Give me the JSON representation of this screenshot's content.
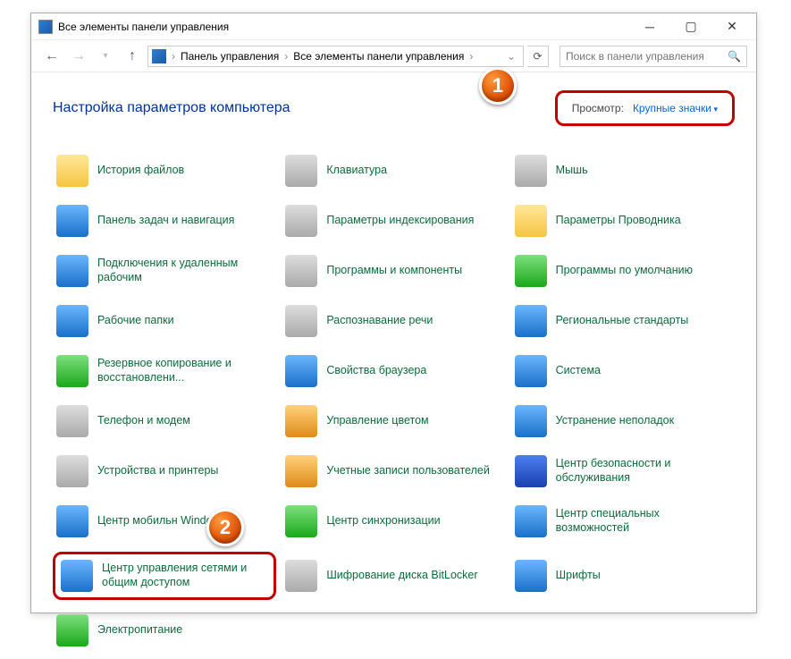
{
  "window": {
    "title": "Все элементы панели управления"
  },
  "nav": {
    "breadcrumb": [
      "Панель управления",
      "Все элементы панели управления"
    ],
    "search_placeholder": "Поиск в панели управления"
  },
  "heading": "Настройка параметров компьютера",
  "view": {
    "label": "Просмотр:",
    "value": "Крупные значки"
  },
  "badges": {
    "one": "1",
    "two": "2"
  },
  "items": [
    {
      "label": "История файлов",
      "icon": "folder-history-icon",
      "cls": "ic-folder"
    },
    {
      "label": "Клавиатура",
      "icon": "keyboard-icon",
      "cls": "ic-gray"
    },
    {
      "label": "Мышь",
      "icon": "mouse-icon",
      "cls": "ic-gray"
    },
    {
      "label": "Панель задач и навигация",
      "icon": "taskbar-icon",
      "cls": "ic-blue"
    },
    {
      "label": "Параметры индексирования",
      "icon": "indexing-icon",
      "cls": "ic-gray"
    },
    {
      "label": "Параметры Проводника",
      "icon": "explorer-options-icon",
      "cls": "ic-folder"
    },
    {
      "label": "Подключения к удаленным рабочим",
      "icon": "remote-apps-icon",
      "cls": "ic-blue"
    },
    {
      "label": "Программы и компоненты",
      "icon": "programs-features-icon",
      "cls": "ic-gray"
    },
    {
      "label": "Программы по умолчанию",
      "icon": "default-programs-icon",
      "cls": "ic-green"
    },
    {
      "label": "Рабочие папки",
      "icon": "work-folders-icon",
      "cls": "ic-blue"
    },
    {
      "label": "Распознавание речи",
      "icon": "speech-icon",
      "cls": "ic-gray"
    },
    {
      "label": "Региональные стандарты",
      "icon": "region-icon",
      "cls": "ic-blue"
    },
    {
      "label": "Резервное копирование и восстановлени...",
      "icon": "backup-icon",
      "cls": "ic-green"
    },
    {
      "label": "Свойства браузера",
      "icon": "internet-options-icon",
      "cls": "ic-blue"
    },
    {
      "label": "Система",
      "icon": "system-icon",
      "cls": "ic-blue"
    },
    {
      "label": "Телефон и модем",
      "icon": "phone-modem-icon",
      "cls": "ic-gray"
    },
    {
      "label": "Управление цветом",
      "icon": "color-mgmt-icon",
      "cls": "ic-orange"
    },
    {
      "label": "Устранение неполадок",
      "icon": "troubleshoot-icon",
      "cls": "ic-blue"
    },
    {
      "label": "Устройства и принтеры",
      "icon": "devices-printers-icon",
      "cls": "ic-gray"
    },
    {
      "label": "Учетные записи пользователей",
      "icon": "user-accounts-icon",
      "cls": "ic-orange"
    },
    {
      "label": "Центр безопасности и обслуживания",
      "icon": "security-center-icon",
      "cls": "ic-flag"
    },
    {
      "label": "Центр мобильн Windows",
      "icon": "mobility-center-icon",
      "cls": "ic-blue"
    },
    {
      "label": "Центр синхронизации",
      "icon": "sync-center-icon",
      "cls": "ic-green"
    },
    {
      "label": "Центр специальных возможностей",
      "icon": "ease-access-icon",
      "cls": "ic-blue"
    },
    {
      "label": "Центр управления сетями и общим доступом",
      "icon": "network-sharing-icon",
      "cls": "ic-blue",
      "highlight": true
    },
    {
      "label": "Шифрование диска BitLocker",
      "icon": "bitlocker-icon",
      "cls": "ic-gray"
    },
    {
      "label": "Шрифты",
      "icon": "fonts-icon",
      "cls": "ic-blue"
    },
    {
      "label": "Электропитание",
      "icon": "power-options-icon",
      "cls": "ic-green"
    }
  ]
}
